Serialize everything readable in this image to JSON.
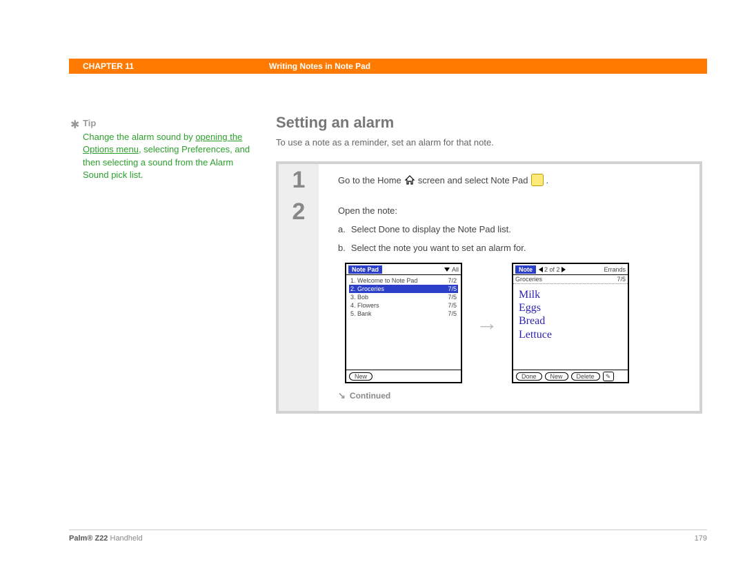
{
  "header": {
    "chapter": "CHAPTER 11",
    "title": "Writing Notes in Note Pad"
  },
  "tip": {
    "label": "Tip",
    "text_pre": "Change the alarm sound by ",
    "link": "opening the Options menu",
    "text_post": ", selecting Preferences, and then selecting a sound from the Alarm Sound pick list."
  },
  "section": {
    "title": "Setting an alarm",
    "intro": "To use a note as a reminder, set an alarm for that note."
  },
  "step1": {
    "num": "1",
    "p1": "Go to the Home",
    "p2": "screen and select Note Pad",
    "p3": "."
  },
  "step2": {
    "num": "2",
    "open": "Open the note:",
    "a_letter": "a.",
    "a_text": "Select Done to display the Note Pad list.",
    "b_letter": "b.",
    "b_text": "Select the note you want to set an alarm for."
  },
  "list_screen": {
    "title": "Note Pad",
    "filter": "All",
    "rows": [
      {
        "title": "1.  Welcome to Note Pad",
        "date": "7/2"
      },
      {
        "title": "2.  Groceries",
        "date": "7/5",
        "selected": true
      },
      {
        "title": "3.  Bob",
        "date": "7/5"
      },
      {
        "title": "4.  Flowers",
        "date": "7/5"
      },
      {
        "title": "5.  Bank",
        "date": "7/5"
      }
    ],
    "btn_new": "New"
  },
  "note_screen": {
    "title": "Note",
    "counter": "2 of 2",
    "category": "Errands",
    "note_name": "Groceries",
    "note_date": "7/5",
    "lines": [
      "Milk",
      "Eggs",
      "Bread",
      "Lettuce"
    ],
    "btn_done": "Done",
    "btn_new": "New",
    "btn_delete": "Delete"
  },
  "continued": "Continued",
  "footer": {
    "brand": "Palm®",
    "model": "Z22",
    "suffix": "Handheld",
    "page": "179"
  }
}
